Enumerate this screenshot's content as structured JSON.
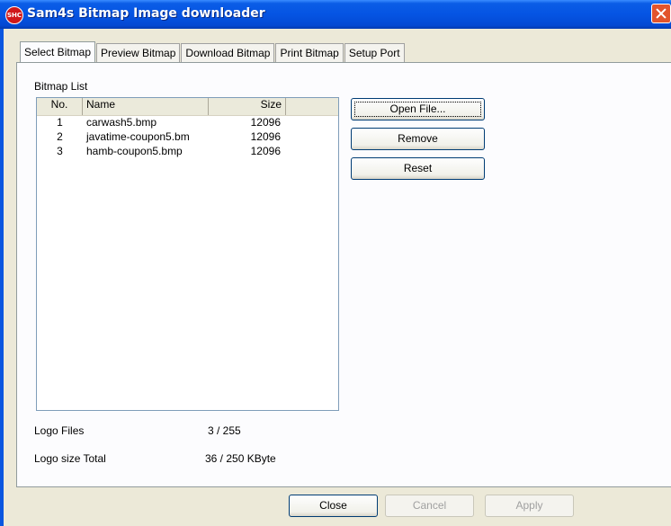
{
  "window": {
    "title": "Sam4s Bitmap Image downloader",
    "icon_text": "SHC"
  },
  "tabs": [
    {
      "label": "Select Bitmap",
      "active": true
    },
    {
      "label": "Preview Bitmap",
      "active": false
    },
    {
      "label": "Download Bitmap",
      "active": false
    },
    {
      "label": "Print Bitmap",
      "active": false
    },
    {
      "label": "Setup Port",
      "active": false
    }
  ],
  "bitmap_list": {
    "label": "Bitmap List",
    "columns": {
      "no": "No.",
      "name": "Name",
      "size": "Size"
    },
    "rows": [
      {
        "no": "1",
        "name": "carwash5.bmp",
        "size": "12096"
      },
      {
        "no": "2",
        "name": "javatime-coupon5.bm",
        "size": "12096"
      },
      {
        "no": "3",
        "name": "hamb-coupon5.bmp",
        "size": "12096"
      }
    ]
  },
  "buttons": {
    "open_file": "Open File...",
    "remove": "Remove",
    "reset": "Reset"
  },
  "info": {
    "logo_files_label": "Logo Files",
    "logo_files_value": "3 / 255",
    "logo_size_label": "Logo size Total",
    "logo_size_value": "36 / 250 KByte"
  },
  "footer": {
    "close": "Close",
    "cancel": "Cancel",
    "apply": "Apply"
  }
}
